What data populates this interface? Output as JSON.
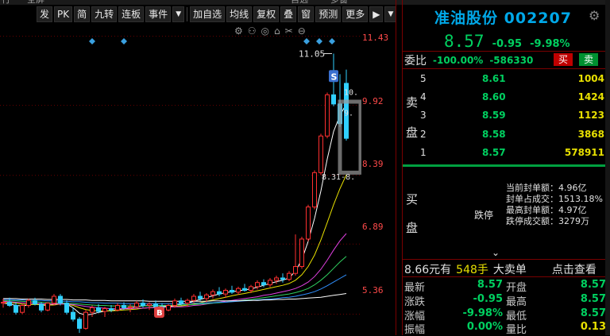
{
  "top_strip": [
    "行",
    "全屏",
    "",
    "",
    "",
    "",
    "自选",
    "",
    "多窗"
  ],
  "toolbar": {
    "items": [
      "发",
      "PK",
      "简",
      "九转",
      "连板",
      "事件",
      "加自选",
      "均线",
      "复权",
      "叠",
      "窗",
      "预测",
      "更多"
    ],
    "event_dropdown": "▼",
    "more_icon": "▶",
    "end_dropdown": "▼"
  },
  "chart_tools": [
    "⚙",
    "⚇",
    "◎",
    "⌂",
    "✂",
    "⊖"
  ],
  "price_axis": {
    "ticks": [
      "11.43",
      "9.92",
      "8.39",
      "6.89",
      "5.36"
    ],
    "tick_values": [
      11.43,
      9.92,
      8.39,
      6.89,
      5.36
    ]
  },
  "chart_annotations": {
    "high_label": "11.05",
    "sell_marker": "S",
    "buy_marker": "B",
    "right_labels": [
      "10.",
      "9.",
      "8.31-8."
    ],
    "color_up": "#ff3030",
    "color_down": "#30d0ff"
  },
  "chart_data": {
    "type": "candlestick",
    "ylim": [
      4.9,
      11.7
    ],
    "candles": [
      [
        5.6,
        5.7,
        5.5,
        5.62
      ],
      [
        5.62,
        5.72,
        5.52,
        5.55
      ],
      [
        5.55,
        5.62,
        5.35,
        5.4
      ],
      [
        5.4,
        5.58,
        5.36,
        5.55
      ],
      [
        5.55,
        5.7,
        5.5,
        5.66
      ],
      [
        5.66,
        5.72,
        5.55,
        5.58
      ],
      [
        5.58,
        5.62,
        5.4,
        5.45
      ],
      [
        5.45,
        5.62,
        5.42,
        5.6
      ],
      [
        5.6,
        5.8,
        5.55,
        5.75
      ],
      [
        5.75,
        5.8,
        5.55,
        5.6
      ],
      [
        5.6,
        5.66,
        5.35,
        5.4
      ],
      [
        5.4,
        5.5,
        5.2,
        5.25
      ],
      [
        5.25,
        5.3,
        4.95,
        5.05
      ],
      [
        5.05,
        5.45,
        5.02,
        5.4
      ],
      [
        5.4,
        5.55,
        5.3,
        5.5
      ],
      [
        5.5,
        5.58,
        5.38,
        5.42
      ],
      [
        5.42,
        5.52,
        5.3,
        5.48
      ],
      [
        5.48,
        5.56,
        5.4,
        5.45
      ],
      [
        5.45,
        5.6,
        5.42,
        5.55
      ],
      [
        5.55,
        5.62,
        5.45,
        5.5
      ],
      [
        5.5,
        5.58,
        5.4,
        5.52
      ],
      [
        5.52,
        5.65,
        5.48,
        5.6
      ],
      [
        5.6,
        5.68,
        5.5,
        5.55
      ],
      [
        5.55,
        5.62,
        5.45,
        5.58
      ],
      [
        5.58,
        5.66,
        5.48,
        5.52
      ],
      [
        5.52,
        5.6,
        5.4,
        5.45
      ],
      [
        5.45,
        5.58,
        5.42,
        5.55
      ],
      [
        5.55,
        5.7,
        5.5,
        5.65
      ],
      [
        5.65,
        5.72,
        5.55,
        5.6
      ],
      [
        5.6,
        5.7,
        5.52,
        5.66
      ],
      [
        5.66,
        5.8,
        5.6,
        5.75
      ],
      [
        5.75,
        5.85,
        5.65,
        5.7
      ],
      [
        5.7,
        5.82,
        5.62,
        5.78
      ],
      [
        5.78,
        5.9,
        5.7,
        5.85
      ],
      [
        5.85,
        5.95,
        5.75,
        5.8
      ],
      [
        5.8,
        5.92,
        5.72,
        5.88
      ],
      [
        5.88,
        5.98,
        5.8,
        5.84
      ],
      [
        5.84,
        5.96,
        5.78,
        5.92
      ],
      [
        5.92,
        6.02,
        5.85,
        5.88
      ],
      [
        5.88,
        6.0,
        5.82,
        5.96
      ],
      [
        5.96,
        6.1,
        5.9,
        6.05
      ],
      [
        6.05,
        6.12,
        5.95,
        6.0
      ],
      [
        6.0,
        6.15,
        5.95,
        6.1
      ],
      [
        6.1,
        6.2,
        6.02,
        6.15
      ],
      [
        6.15,
        6.25,
        6.05,
        6.12
      ],
      [
        6.12,
        6.3,
        6.08,
        6.25
      ],
      [
        6.25,
        7.1,
        6.2,
        6.4
      ],
      [
        6.4,
        7.05,
        6.35,
        7.0
      ],
      [
        7.0,
        7.75,
        6.95,
        7.7
      ],
      [
        7.7,
        8.5,
        7.65,
        8.45
      ],
      [
        8.45,
        9.3,
        8.4,
        9.25
      ],
      [
        9.25,
        10.2,
        9.2,
        10.15
      ],
      [
        10.15,
        11.05,
        9.9,
        9.95
      ],
      [
        9.95,
        10.6,
        9.45,
        9.52
      ],
      [
        10.4,
        10.7,
        9.15,
        9.2
      ]
    ],
    "moving_averages": [
      {
        "color": "#ffffff",
        "values": [
          5.6,
          5.58,
          5.55,
          5.54,
          5.56,
          5.58,
          5.56,
          5.55,
          5.58,
          5.62,
          5.58,
          5.5,
          5.38,
          5.34,
          5.36,
          5.4,
          5.42,
          5.44,
          5.46,
          5.48,
          5.5,
          5.52,
          5.54,
          5.55,
          5.55,
          5.54,
          5.53,
          5.55,
          5.58,
          5.6,
          5.64,
          5.68,
          5.72,
          5.76,
          5.8,
          5.83,
          5.85,
          5.87,
          5.89,
          5.91,
          5.95,
          5.99,
          6.03,
          6.07,
          6.1,
          6.15,
          6.3,
          6.55,
          6.95,
          7.45,
          8.05,
          8.75,
          9.35,
          9.7,
          9.95
        ]
      },
      {
        "color": "#e8e000",
        "values": [
          5.62,
          5.61,
          5.6,
          5.58,
          5.57,
          5.57,
          5.57,
          5.56,
          5.56,
          5.58,
          5.58,
          5.55,
          5.5,
          5.46,
          5.44,
          5.43,
          5.43,
          5.43,
          5.44,
          5.45,
          5.46,
          5.47,
          5.49,
          5.5,
          5.51,
          5.52,
          5.52,
          5.53,
          5.54,
          5.56,
          5.58,
          5.61,
          5.64,
          5.67,
          5.7,
          5.73,
          5.76,
          5.79,
          5.81,
          5.84,
          5.87,
          5.9,
          5.93,
          5.96,
          5.99,
          6.03,
          6.1,
          6.22,
          6.4,
          6.65,
          6.98,
          7.36,
          7.75,
          8.1,
          8.4
        ]
      },
      {
        "color": "#e040e0",
        "values": [
          5.64,
          5.63,
          5.62,
          5.61,
          5.6,
          5.6,
          5.59,
          5.58,
          5.58,
          5.58,
          5.58,
          5.57,
          5.55,
          5.53,
          5.51,
          5.5,
          5.49,
          5.48,
          5.48,
          5.48,
          5.48,
          5.49,
          5.49,
          5.5,
          5.5,
          5.51,
          5.51,
          5.52,
          5.52,
          5.53,
          5.55,
          5.56,
          5.58,
          5.6,
          5.62,
          5.64,
          5.66,
          5.68,
          5.7,
          5.72,
          5.74,
          5.77,
          5.79,
          5.82,
          5.85,
          5.88,
          5.92,
          5.98,
          6.06,
          6.18,
          6.34,
          6.54,
          6.76,
          6.96,
          7.12
        ]
      },
      {
        "color": "#30d060",
        "values": [
          5.66,
          5.65,
          5.65,
          5.64,
          5.63,
          5.63,
          5.62,
          5.61,
          5.61,
          5.6,
          5.6,
          5.59,
          5.58,
          5.57,
          5.56,
          5.55,
          5.55,
          5.54,
          5.54,
          5.54,
          5.54,
          5.54,
          5.54,
          5.54,
          5.55,
          5.55,
          5.55,
          5.56,
          5.56,
          5.57,
          5.57,
          5.58,
          5.59,
          5.6,
          5.61,
          5.62,
          5.64,
          5.65,
          5.67,
          5.68,
          5.7,
          5.72,
          5.74,
          5.76,
          5.78,
          5.8,
          5.83,
          5.87,
          5.92,
          6.0,
          6.1,
          6.22,
          6.36,
          6.5,
          6.62
        ]
      },
      {
        "color": "#3090ff",
        "values": [
          5.68,
          5.68,
          5.67,
          5.67,
          5.66,
          5.66,
          5.66,
          5.65,
          5.65,
          5.64,
          5.64,
          5.63,
          5.63,
          5.62,
          5.61,
          5.61,
          5.6,
          5.6,
          5.6,
          5.59,
          5.59,
          5.59,
          5.59,
          5.59,
          5.59,
          5.59,
          5.59,
          5.59,
          5.59,
          5.6,
          5.6,
          5.6,
          5.61,
          5.61,
          5.62,
          5.62,
          5.63,
          5.64,
          5.65,
          5.66,
          5.67,
          5.68,
          5.69,
          5.7,
          5.72,
          5.73,
          5.75,
          5.78,
          5.81,
          5.85,
          5.91,
          5.98,
          6.06,
          6.14,
          6.22
        ]
      },
      {
        "color": "#ffffff",
        "values": [
          5.7,
          5.7,
          5.7,
          5.69,
          5.69,
          5.69,
          5.69,
          5.68,
          5.68,
          5.68,
          5.68,
          5.67,
          5.67,
          5.67,
          5.66,
          5.66,
          5.66,
          5.65,
          5.65,
          5.65,
          5.65,
          5.65,
          5.65,
          5.64,
          5.64,
          5.64,
          5.64,
          5.64,
          5.64,
          5.64,
          5.64,
          5.64,
          5.64,
          5.65,
          5.65,
          5.65,
          5.65,
          5.65,
          5.66,
          5.66,
          5.66,
          5.67,
          5.67,
          5.68,
          5.68,
          5.69,
          5.69,
          5.7,
          5.71,
          5.72,
          5.73,
          5.75,
          5.77,
          5.79,
          5.81
        ]
      }
    ]
  },
  "panel": {
    "stock_name": "准油股份",
    "stock_code": "002207",
    "gear_icon": "⚙",
    "price": "8.57",
    "change": "-0.95",
    "change_pct": "-9.98%",
    "webi_label": "委比",
    "webi_pct": "-100.00%",
    "webi_diff": "-586330",
    "buy_btn": "买",
    "sell_btn": "卖",
    "sell_side_label": [
      "卖",
      "盘"
    ],
    "asks": [
      {
        "lvl": "5",
        "price": "8.61",
        "vol": "1004"
      },
      {
        "lvl": "4",
        "price": "8.60",
        "vol": "1424"
      },
      {
        "lvl": "3",
        "price": "8.59",
        "vol": "1123"
      },
      {
        "lvl": "2",
        "price": "8.58",
        "vol": "3868"
      },
      {
        "lvl": "1",
        "price": "8.57",
        "vol": "578911"
      }
    ],
    "buy_side_label": [
      "买",
      "盘"
    ],
    "limit_down": "跌停",
    "limit_info": [
      {
        "k": "当前封单额：",
        "v": "4.96亿"
      },
      {
        "k": "封单占成交：",
        "v": "1513.18%"
      },
      {
        "k": "最高封单额：",
        "v": "4.97亿"
      },
      {
        "k": "跌停成交额：",
        "v": "3279万"
      }
    ],
    "chevron": "⌄",
    "big_order": {
      "price": "8.66元有",
      "lots": "548手",
      "label": "大卖单",
      "link": "点击查看"
    },
    "quote": [
      {
        "k1": "最新",
        "v1": "8.57",
        "k2": "开盘",
        "v2": "8.57"
      },
      {
        "k1": "涨跌",
        "v1": "-0.95",
        "k2": "最高",
        "v2": "8.57"
      },
      {
        "k1": "涨幅",
        "v1": "-9.98%",
        "k2": "最低",
        "v2": "8.57"
      },
      {
        "k1": "振幅",
        "v1": "0.00%",
        "k2": "量比",
        "v2": "0.13"
      }
    ]
  }
}
